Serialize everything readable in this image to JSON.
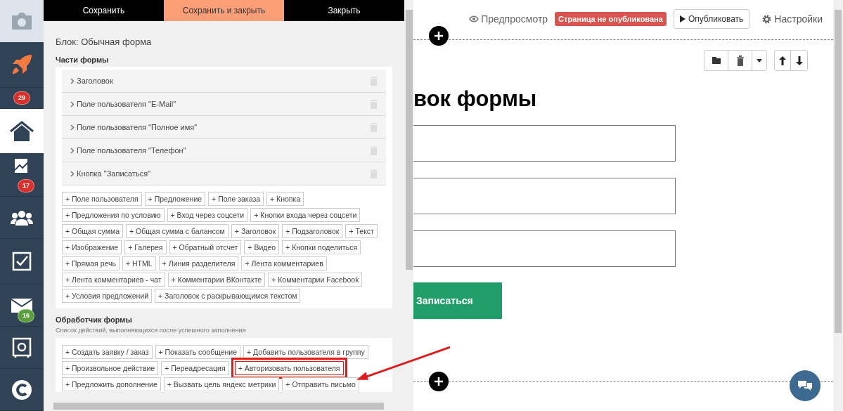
{
  "sidebar": {
    "items": [
      {
        "kind": "camera"
      },
      {
        "kind": "rocket",
        "selected": false
      },
      {
        "kind": "badge",
        "badge": "29",
        "color": "#d9302c"
      },
      {
        "kind": "home",
        "selected": true
      },
      {
        "kind": "chart",
        "selected": false,
        "badge": "17",
        "color": "#d9302c"
      },
      {
        "kind": "people",
        "selected": false
      },
      {
        "kind": "task",
        "selected": false
      },
      {
        "kind": "mail",
        "selected": false,
        "badge": "16",
        "color": "#5a9e3a"
      },
      {
        "kind": "safe",
        "selected": false
      },
      {
        "kind": "logo",
        "selected": false
      }
    ]
  },
  "panel": {
    "actions": [
      {
        "label": "Сохранить",
        "selected": false
      },
      {
        "label": "Сохранить и закрыть",
        "selected": true
      },
      {
        "label": "Закрыть",
        "selected": false
      }
    ],
    "block_title": "Блок: Обычная форма",
    "parts_heading": "Части формы",
    "parts": [
      "Заголовок",
      "Поле пользователя \"E-Mail\"",
      "Поле пользователя \"Полное имя\"",
      "Поле пользователя \"Телефон\"",
      "Кнопка \"Записаться\""
    ],
    "add_buttons": [
      "+ Поле пользователя",
      "+ Предложение",
      "+ Поле заказа",
      "+ Кнопка",
      "+ Предложения по условию",
      "+ Вход через соцсети",
      "+ Кнопки входа через соцсети",
      "+ Общая сумма",
      "+ Общая сумма с балансом",
      "+ Заголовок",
      "+ Подзаголовок",
      "+ Текст",
      "+ Изображение",
      "+ Галерея",
      "+ Обратный отсчет",
      "+ Видео",
      "+ Кнопки поделиться",
      "+ Прямая речь",
      "+ HTML",
      "+ Линия разделителя",
      "+ Лента комментариев",
      "+ Лента комментариев - чат",
      "+ Комментарии ВКонтакте",
      "+ Комментарии Facebook",
      "+ Условия предложений",
      "+ Заголовок с раскрывающимся текстом"
    ],
    "handler_heading": "Обработчик формы",
    "handler_hint": "Список действий, выполняющихся после успешного заполнения",
    "handler_buttons": [
      {
        "label": "+ Создать заявку / заказ",
        "highlighted": false
      },
      {
        "label": "+ Показать сообщение",
        "highlighted": false
      },
      {
        "label": "+ Добавить пользователя в группу",
        "highlighted": false
      },
      {
        "label": "+ Произвольное действие",
        "highlighted": false
      },
      {
        "label": "+ Переадресация",
        "highlighted": false
      },
      {
        "label": "+ Авторизовать пользователя",
        "highlighted": true
      },
      {
        "label": "+ Предложить дополнение",
        "highlighted": false
      },
      {
        "label": "+ Вызвать цель яндекс метрики",
        "highlighted": false
      },
      {
        "label": "+ Отправить письмо",
        "highlighted": false
      }
    ]
  },
  "topbar": {
    "preview": "Предпросмотр",
    "status_badge": "Страница не опубликована",
    "publish": "Опубликовать",
    "settings": "Настройки"
  },
  "canvas": {
    "heading": "вок формы",
    "submit": "Записаться"
  }
}
